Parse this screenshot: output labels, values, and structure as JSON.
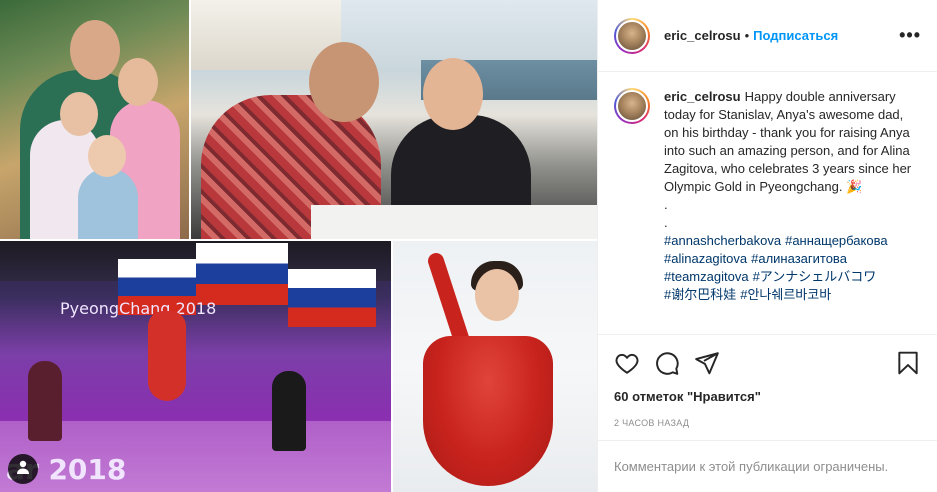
{
  "post": {
    "author": "eric_celrosu",
    "header_dot": "•",
    "follow_label": "Подписаться",
    "more_label": "•••",
    "caption_body": "Happy double anniversary today for Stanislav, Anya's awesome dad, on his birthday - thank you for raising Anya into such an amazing person, and for Alina Zagitova, who celebrates 3 years since her Olympic Gold in Pyeongchang. 🎉",
    "dot1": ".",
    "dot2": ".",
    "hashtags": [
      "#annashcherbakova",
      "#аннащербакова",
      "#alinazagitova",
      "#алиназагитова",
      "#teamzagitova",
      "#アンナシェルバコワ",
      "#谢尔巴科娃",
      "#안나쉐르바코바"
    ],
    "likes_text": "60 отметок \"Нравится\"",
    "time_text": "2 ЧАСОВ НАЗАД",
    "comments_closed": "Комментарии к этой публикации ограничены."
  },
  "media": {
    "image_text": {
      "olympic_logo_text": "PyeongChang 2018",
      "bottom_2018": "ar 2018"
    }
  },
  "icons": {
    "like": "heart-icon",
    "comment": "comment-icon",
    "share": "paper-plane-icon",
    "save": "bookmark-icon",
    "user_tag": "user-icon"
  },
  "colors": {
    "follow": "#0095f6",
    "hashtag": "#00376b",
    "muted": "#8e8e8e"
  }
}
